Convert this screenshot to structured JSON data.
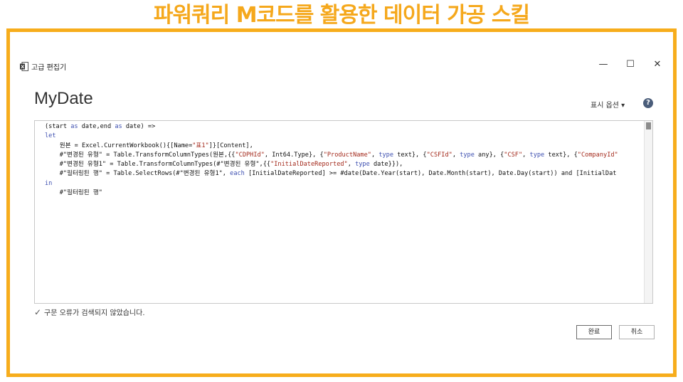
{
  "banner": {
    "title": "파워쿼리 M코드를 활용한 데이터 가공 스킬"
  },
  "window": {
    "title": "고급 편집기",
    "minimize": "—",
    "maximize": "☐",
    "close": "✕"
  },
  "editor": {
    "query_name": "MyDate",
    "display_options": "표시 옵션 ▾",
    "help": "?",
    "code_lines": [
      "(start as date,end as date) =>",
      "let",
      "    원본 = Excel.CurrentWorkbook(){[Name=\"표1\"]}[Content],",
      "    #\"변경된 유형\" = Table.TransformColumnTypes(원본,{{\"CDPHId\", Int64.Type}, {\"ProductName\", type text}, {\"CSFId\", type any}, {\"CSF\", type text}, {\"CompanyId\"",
      "    #\"변경된 유형1\" = Table.TransformColumnTypes(#\"변경된 유형\",{{\"InitialDateReported\", type date}}),",
      "    #\"필터링된 행\" = Table.SelectRows(#\"변경된 유형1\", each [InitialDateReported] >= #date(Date.Year(start), Date.Month(start), Date.Day(start)) and [InitialDat",
      "in",
      "    #\"필터링된 행\""
    ]
  },
  "status": {
    "message": "구문 오류가 검색되지 않았습니다."
  },
  "buttons": {
    "done": "완료",
    "cancel": "취소"
  }
}
